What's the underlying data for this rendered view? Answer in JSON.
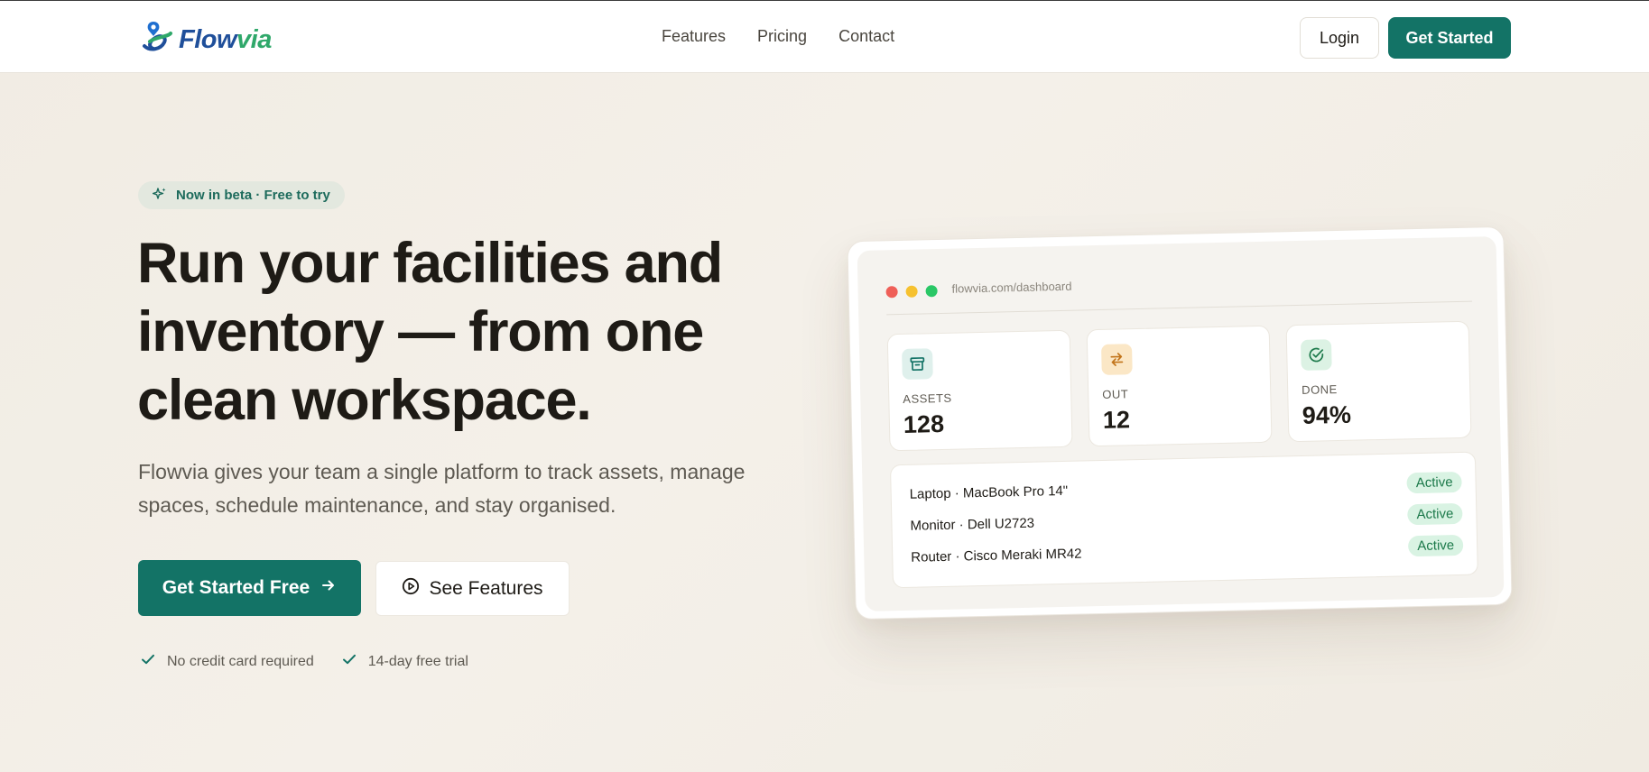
{
  "header": {
    "logo_text_main": "Flow",
    "logo_text_accent": "via",
    "nav": [
      "Features",
      "Pricing",
      "Contact"
    ],
    "login_label": "Login",
    "get_started_label": "Get Started"
  },
  "hero": {
    "badge": "Now in beta · Free to try",
    "title": "Run your facilities and inventory — from one clean workspace.",
    "lead": "Flowvia gives your team a single platform to track assets, manage spaces, schedule maintenance, and stay organised.",
    "cta_primary": "Get Started Free",
    "cta_secondary": "See Features",
    "perks": [
      "No credit card required",
      "14-day free trial"
    ]
  },
  "dashboard": {
    "url": "flowvia.com/dashboard",
    "stats": [
      {
        "label": "ASSETS",
        "value": "128",
        "icon": "archive-icon",
        "color": "#137366",
        "bg": "#dff0ec"
      },
      {
        "label": "OUT",
        "value": "12",
        "icon": "swap-icon",
        "color": "#c2741a",
        "bg": "#fbe7c6"
      },
      {
        "label": "DONE",
        "value": "94%",
        "icon": "check-circle-icon",
        "color": "#1d7a4b",
        "bg": "#dcf2e4"
      }
    ],
    "rows": [
      {
        "name": "Laptop · MacBook Pro 14\"",
        "status": "Active"
      },
      {
        "name": "Monitor · Dell U2723",
        "status": "Active"
      },
      {
        "name": "Router · Cisco Meraki MR42",
        "status": "Active"
      }
    ]
  },
  "colors": {
    "brand": "#137366",
    "logo_blue": "#1f4f9a",
    "logo_green": "#2fa86a",
    "dot_red": "#ef5f58",
    "dot_yellow": "#f6c12f",
    "dot_green": "#2ac766"
  }
}
